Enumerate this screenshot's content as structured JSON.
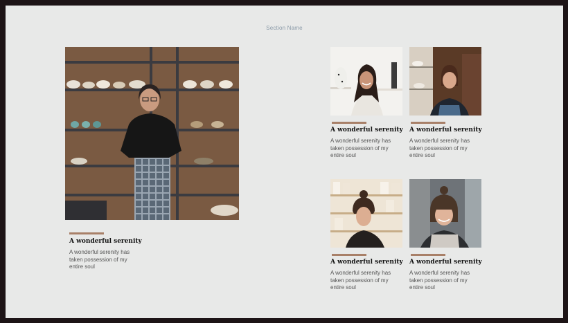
{
  "section": {
    "name": "Section Name"
  },
  "colors": {
    "background": "#e8e9e8",
    "accent_bar": "#a88068",
    "frame": "#1d1416"
  },
  "featured": {
    "image": "woman-in-pottery-studio-photo",
    "title": "A wonderful serenity",
    "description": "A wonderful serenity has taken possession of my entire soul"
  },
  "grid": [
    {
      "image": "woman-smiling-studio-photo",
      "title": "A wonderful serenity",
      "description": "A wonderful serenity has taken possession of my entire soul"
    },
    {
      "image": "woman-in-apron-photo",
      "title": "A wonderful serenity",
      "description": "A wonderful serenity has taken possession of my entire soul"
    },
    {
      "image": "woman-with-bun-pottery-shelves-photo",
      "title": "A wonderful serenity",
      "description": "A wonderful serenity has taken possession of my entire soul"
    },
    {
      "image": "woman-smiling-portrait-photo",
      "title": "A wonderful serenity",
      "description": "A wonderful serenity has taken possession of my entire soul"
    }
  ]
}
